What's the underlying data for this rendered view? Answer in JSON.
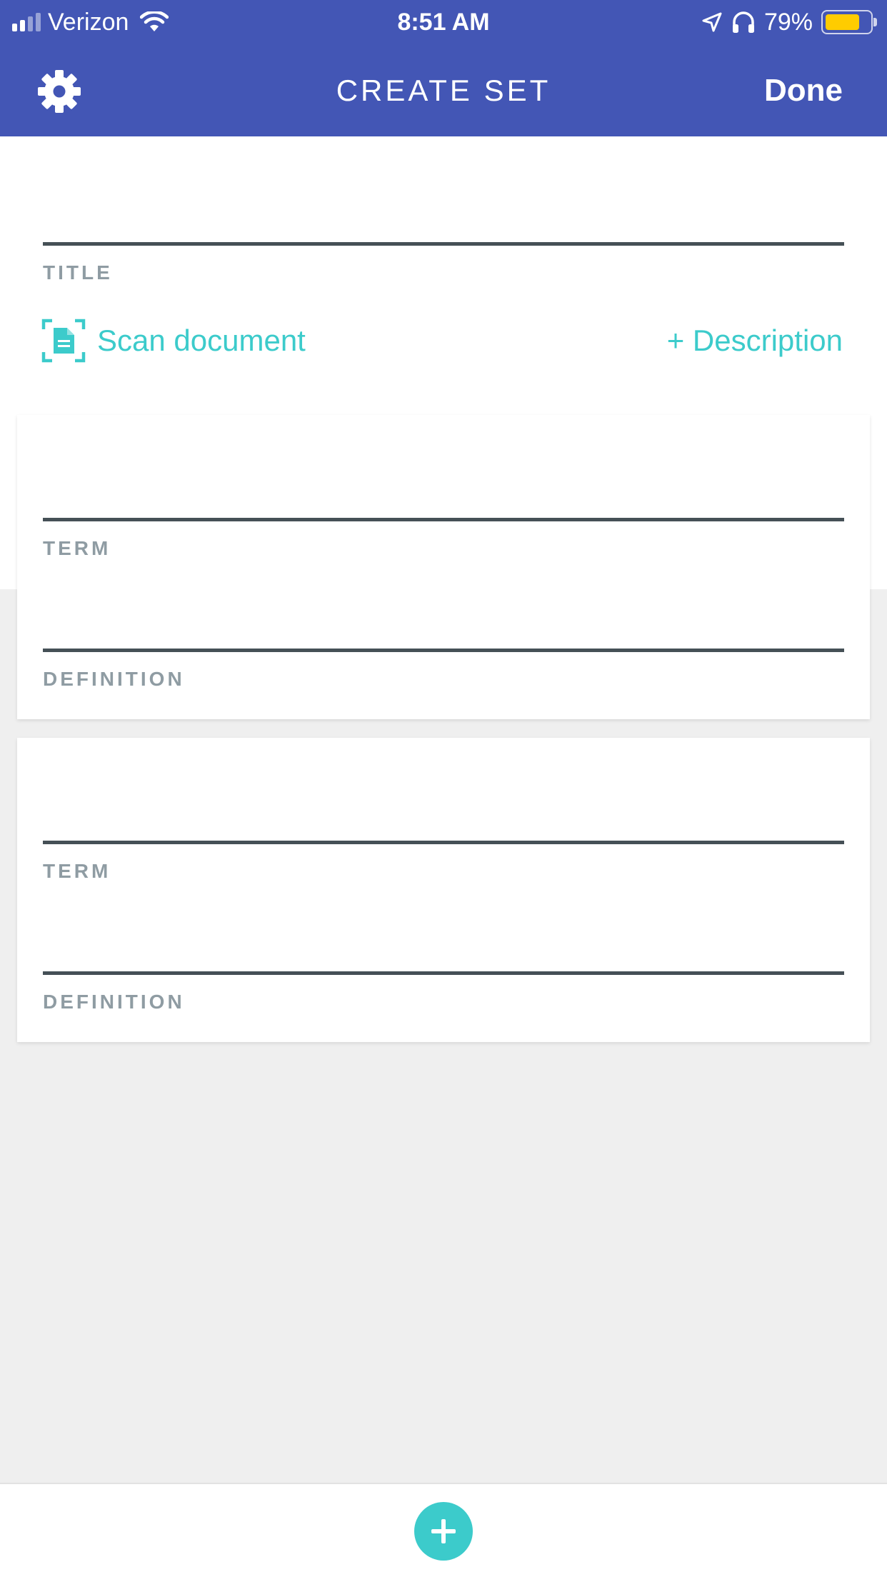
{
  "status_bar": {
    "carrier": "Verizon",
    "time": "8:51 AM",
    "battery_percent": "79%",
    "battery_level": 0.79,
    "signal_bars": 2,
    "icons": [
      "signal-icon",
      "wifi-icon",
      "location-arrow-icon",
      "headphones-icon",
      "battery-icon"
    ]
  },
  "nav": {
    "settings_icon": "gear-icon",
    "title": "CREATE SET",
    "done_label": "Done"
  },
  "title_section": {
    "title_value": "",
    "title_label": "TITLE",
    "scan_icon": "scan-document-icon",
    "scan_label": "Scan document",
    "description_label": "+ Description"
  },
  "cards": [
    {
      "term_value": "",
      "term_label": "TERM",
      "definition_value": "",
      "definition_label": "DEFINITION"
    },
    {
      "term_value": "",
      "term_label": "TERM",
      "definition_value": "",
      "definition_label": "DEFINITION"
    }
  ],
  "bottom_bar": {
    "add_icon": "plus-icon"
  },
  "colors": {
    "header_background": "#4356b5",
    "accent": "#3ccbcb",
    "field_line": "#455056",
    "label_text": "#8f9ca3",
    "page_background": "#efefef",
    "battery_fill": "#ffcc00"
  }
}
